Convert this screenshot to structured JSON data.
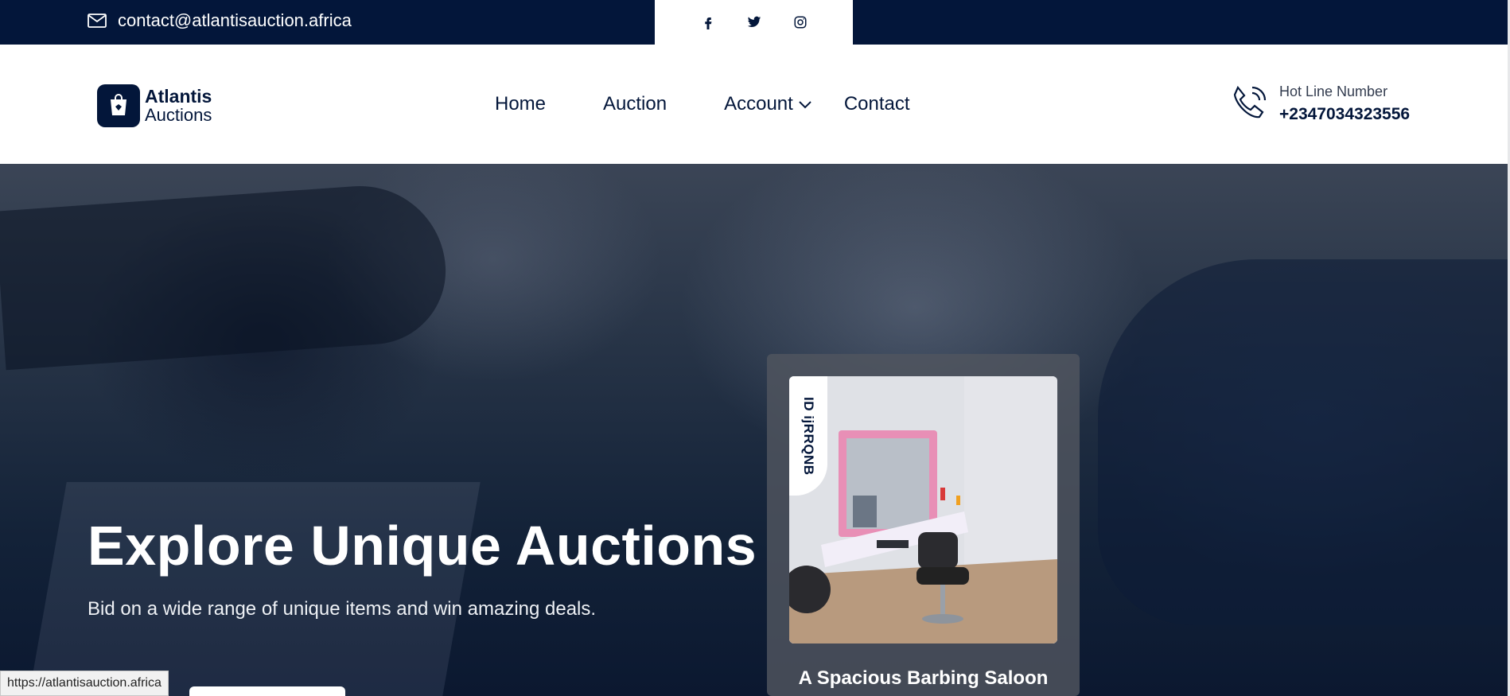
{
  "topbar": {
    "email": "contact@atlantisauction.africa",
    "social_icons": [
      "facebook-icon",
      "twitter-icon",
      "instagram-icon"
    ]
  },
  "header": {
    "logo_line1": "Atlantis",
    "logo_line2": "Auctions",
    "nav": {
      "home": "Home",
      "auction": "Auction",
      "account": "Account",
      "contact": "Contact"
    },
    "hotline_label": "Hot Line Number",
    "hotline_number": "+2347034323556"
  },
  "hero": {
    "title": "Explore Unique Auctions",
    "subtitle": "Bid on a wide range of unique items and win amazing deals."
  },
  "card": {
    "id_label": "ID ijRRQNB",
    "title": "A Spacious Barbing Saloon"
  },
  "status_bar": {
    "url": "https://atlantisauction.africa"
  },
  "colors": {
    "navy": "#03163a",
    "white": "#ffffff"
  }
}
